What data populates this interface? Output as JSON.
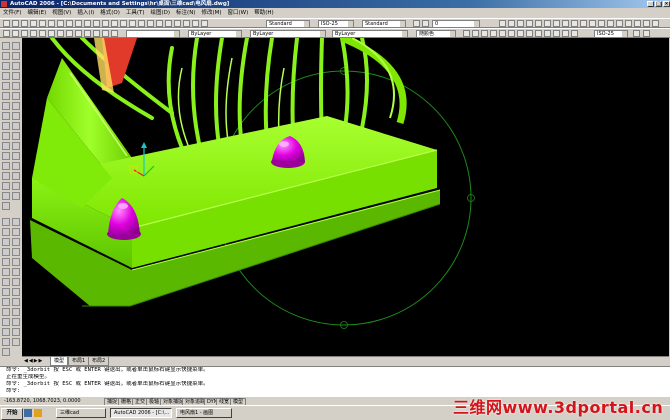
{
  "window": {
    "title": "AutoCAD 2006 - [C:\\Documents and Settings\\hr\\桌面\\三维cad\\电风扇.dwg]"
  },
  "menu": [
    "文件(F)",
    "编辑(E)",
    "视图(V)",
    "插入(I)",
    "格式(O)",
    "工具(T)",
    "绘图(D)",
    "标注(N)",
    "修改(M)",
    "窗口(W)",
    "帮助(H)"
  ],
  "toolbars": {
    "text_style": "Standard",
    "dim_style": "ISO-25",
    "table_style": "Standard",
    "layer": "0",
    "color": "ByLayer",
    "linetype": "ByLayer",
    "lineweight": "ByLayer",
    "plot_style": "随颜色"
  },
  "layout_tabs": [
    "模型",
    "布局1",
    "布局2"
  ],
  "command_lines": [
    "命令: _3dorbit 按 ESC 或 ENTER 键退出，或者单击鼠标右键显示快捷菜单。",
    "正在重生成模型。",
    "命令: _3dorbit 按 ESC 或 ENTER 键退出，或者单击鼠标右键显示快捷菜单。",
    "命令:"
  ],
  "status": {
    "coords": "-163.8720, 1068.7023, 0.0000",
    "buttons": [
      "捕捉",
      "栅格",
      "正交",
      "极轴",
      "对象捕捉",
      "对象追踪",
      "DYN",
      "线宽",
      "模型"
    ]
  },
  "taskbar": {
    "start": "开始",
    "tasks": [
      "三维cad",
      "AutoCAD 2006 - [C:\\...",
      "电风扇1 - 画图"
    ]
  },
  "watermark": "三维网www.3dportal.cn",
  "colors": {
    "model_green": "#86f20c",
    "knob_magenta": "#e000e0",
    "viewport_bg": "#000000",
    "orbit_circle": "#1e8a1e"
  }
}
